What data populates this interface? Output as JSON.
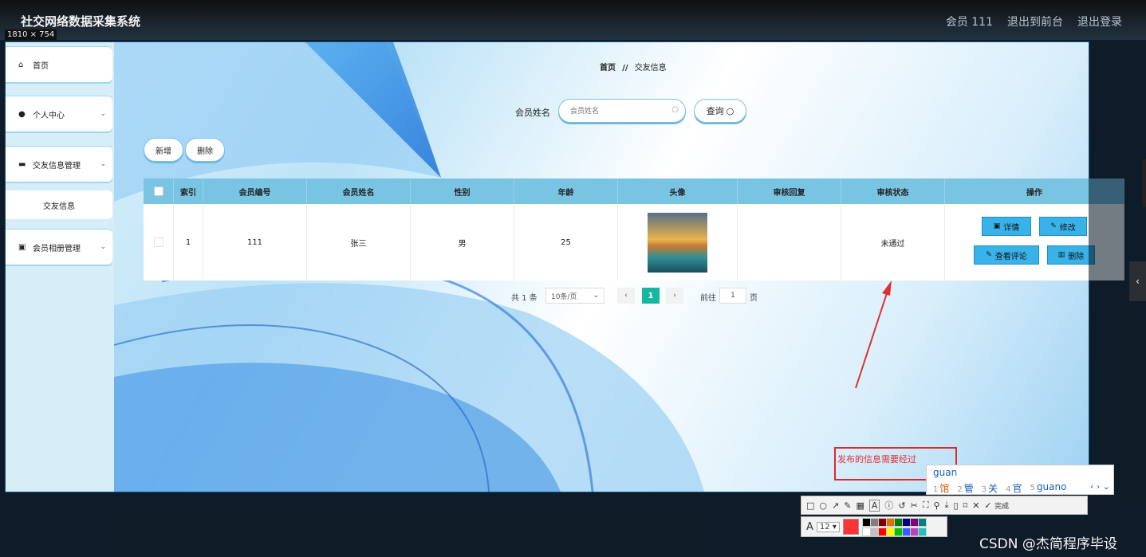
{
  "app": {
    "title": "社交网络数据采集系统",
    "member": "会员 111",
    "nav_front": "退出到前台",
    "nav_logout": "退出登录",
    "capture_size": "1810 × 754"
  },
  "sidebar": {
    "items": [
      {
        "label": "首页",
        "icon": "home-icon"
      },
      {
        "label": "个人中心",
        "icon": "user-icon"
      },
      {
        "label": "交友信息管理",
        "icon": "chat-icon"
      },
      {
        "label": "交友信息",
        "icon": ""
      },
      {
        "label": "会员相册管理",
        "icon": "clipboard-icon"
      }
    ]
  },
  "breadcrumb": {
    "home": "首页",
    "sep": "//",
    "current": "交友信息"
  },
  "search": {
    "label": "会员姓名",
    "placeholder": "会员姓名",
    "button": "查询"
  },
  "actions": {
    "add": "新增",
    "delete": "删除"
  },
  "table": {
    "headers": [
      "",
      "索引",
      "会员编号",
      "会员姓名",
      "性别",
      "年龄",
      "头像",
      "审核回复",
      "审核状态",
      "操作"
    ],
    "rows": [
      {
        "index": "1",
        "member_no": "111",
        "name": "张三",
        "gender": "男",
        "age": "25",
        "reply": "",
        "status": "未通过"
      }
    ],
    "row_buttons": {
      "detail": "详情",
      "edit": "修改",
      "comments": "查看评论",
      "delete": "删除"
    }
  },
  "pager": {
    "total": "共 1 条",
    "size": "10条/页",
    "current": "1",
    "goto": "前往",
    "goto_value": "1",
    "page": "页"
  },
  "annotation": {
    "text": "发布的信息需要经过"
  },
  "ime": {
    "typed": "guan",
    "candidates": [
      {
        "n": "1",
        "w": "馆"
      },
      {
        "n": "2",
        "w": "管"
      },
      {
        "n": "3",
        "w": "关"
      },
      {
        "n": "4",
        "w": "官"
      },
      {
        "n": "5",
        "w": "guano"
      }
    ]
  },
  "screenshot_toolbar": {
    "done": "完成",
    "font_size": "12"
  },
  "watermark": "CSDN @杰简程序毕设",
  "colors": {
    "accent": "#38b2e8",
    "header": "#7ac4e3",
    "page_current": "#16b7a0",
    "annotation": "#d92b2b"
  }
}
